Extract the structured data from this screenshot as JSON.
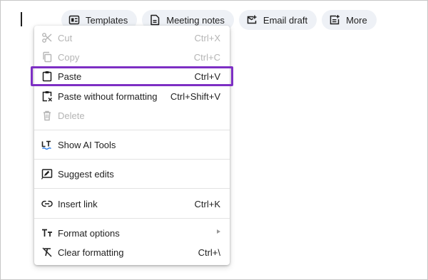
{
  "chips": [
    {
      "label": "Templates",
      "icon": "templates-icon"
    },
    {
      "label": "Meeting notes",
      "icon": "meeting-notes-icon"
    },
    {
      "label": "Email draft",
      "icon": "email-draft-icon"
    },
    {
      "label": "More",
      "icon": "more-icon"
    }
  ],
  "menu": {
    "cut": {
      "label": "Cut",
      "shortcut": "Ctrl+X",
      "icon": "scissors-icon",
      "enabled": false
    },
    "copy": {
      "label": "Copy",
      "shortcut": "Ctrl+C",
      "icon": "copy-icon",
      "enabled": false
    },
    "paste": {
      "label": "Paste",
      "shortcut": "Ctrl+V",
      "icon": "clipboard-icon",
      "highlighted": true
    },
    "paste_plain": {
      "label": "Paste without formatting",
      "shortcut": "Ctrl+Shift+V",
      "icon": "clipboard-plain-icon"
    },
    "delete": {
      "label": "Delete",
      "icon": "trash-icon",
      "enabled": false
    },
    "ai_tools": {
      "label": "Show AI Tools",
      "icon": "ai-tools-icon"
    },
    "suggest": {
      "label": "Suggest edits",
      "icon": "suggest-edit-icon"
    },
    "insert_link": {
      "label": "Insert link",
      "shortcut": "Ctrl+K",
      "icon": "link-icon"
    },
    "format_options": {
      "label": "Format options",
      "icon": "text-format-icon",
      "has_submenu": true
    },
    "clear_formatting": {
      "label": "Clear formatting",
      "shortcut": "Ctrl+\\",
      "icon": "clear-format-icon"
    }
  },
  "colors": {
    "highlight_border": "#7d2fc4",
    "chip_background": "#eef1f6",
    "disabled_text": "#b5b5b5"
  }
}
